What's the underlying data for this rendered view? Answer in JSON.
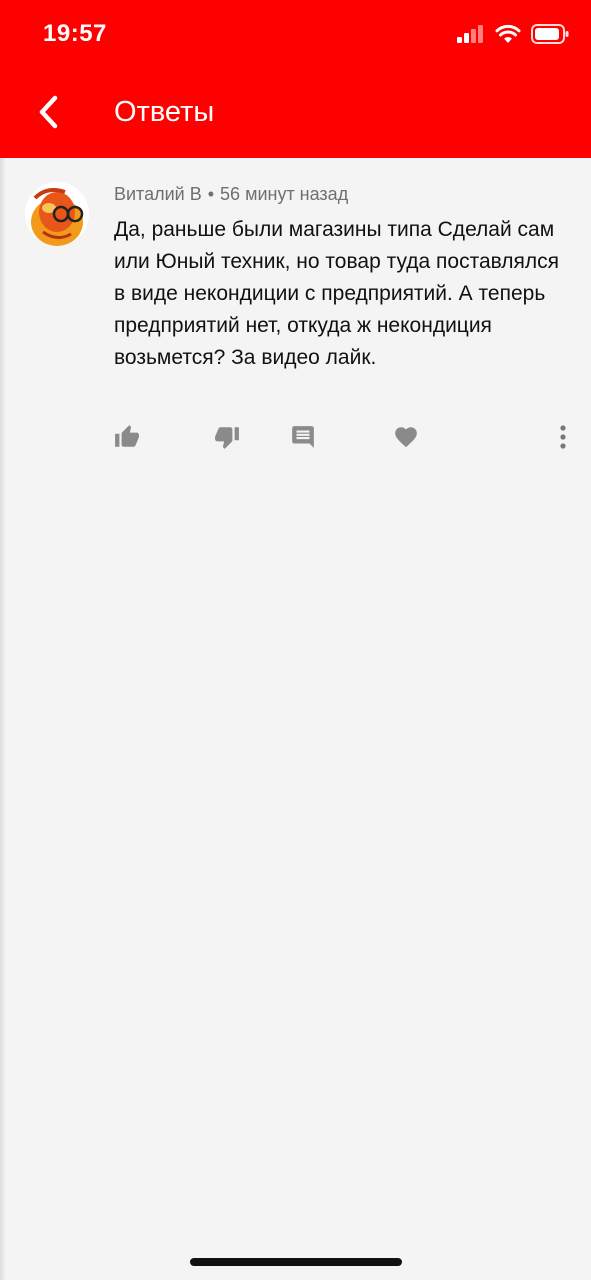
{
  "status_bar": {
    "time": "19:57"
  },
  "header": {
    "title": "Ответы"
  },
  "comment": {
    "author": "Виталий В",
    "separator": "•",
    "time": "56 минут назад",
    "text": "Да, раньше были магазины типа Сделай сам или Юный техник, но товар туда поставлялся в виде некондиции с предприятий. А теперь предприятий нет, откуда ж некондиция возьмется? За видео лайк."
  },
  "actions": [
    {
      "icon": "thumb-up-icon"
    },
    {
      "icon": "thumb-down-icon"
    },
    {
      "icon": "reply-icon"
    },
    {
      "icon": "heart-icon"
    },
    {
      "icon": "more-vertical-icon"
    }
  ],
  "colors": {
    "header_bg": "#ff0000",
    "page_bg": "#f4f4f4",
    "icon_gray": "#8a8a8a",
    "meta_gray": "#6f6f6f"
  }
}
